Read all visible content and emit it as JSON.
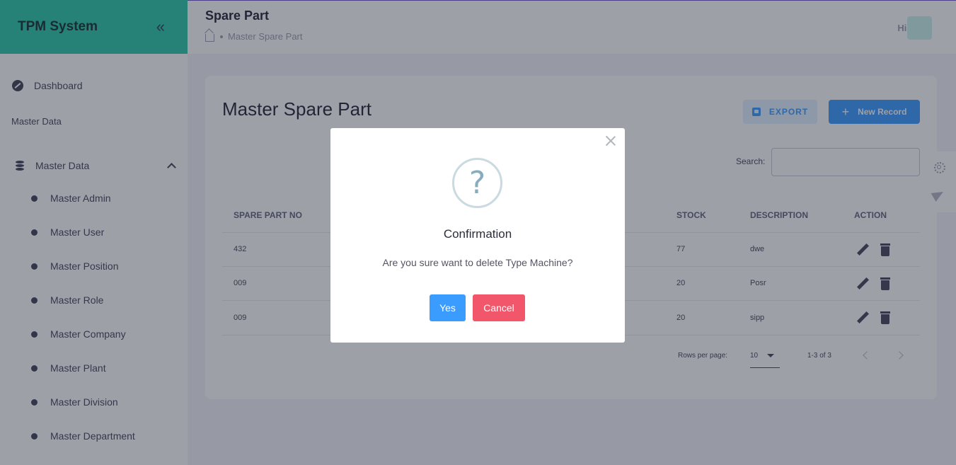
{
  "sidebar": {
    "brand": "TPM System",
    "toggle_glyph": "«",
    "dashboard_label": "Dashboard",
    "section_label": "Master Data",
    "group_label": "Master Data",
    "items": [
      {
        "label": "Master Admin"
      },
      {
        "label": "Master User"
      },
      {
        "label": "Master Position"
      },
      {
        "label": "Master Role"
      },
      {
        "label": "Master Company"
      },
      {
        "label": "Master Plant"
      },
      {
        "label": "Master Division"
      },
      {
        "label": "Master Department"
      }
    ]
  },
  "header": {
    "title": "Spare Part",
    "breadcrumb": "Master Spare Part",
    "greeting": "Hi,"
  },
  "main": {
    "title": "Master Spare Part",
    "export_label": "EXPORT",
    "new_record_label": "New Record",
    "search_label": "Search:",
    "table": {
      "headers": [
        "SPARE PART NO",
        "STOCK",
        "DESCRIPTION",
        "ACTION"
      ],
      "rows": [
        {
          "no": "432",
          "stock": "77",
          "description": "dwe"
        },
        {
          "no": "009",
          "stock": "20",
          "description": "Posr"
        },
        {
          "no": "009",
          "stock": "20",
          "description": "sipp"
        }
      ]
    },
    "pagination": {
      "rows_per_page_label": "Rows per page:",
      "rows_per_page_value": "10",
      "range": "1-3 of 3"
    }
  },
  "modal": {
    "icon_glyph": "?",
    "title": "Confirmation",
    "message": "Are you sure want to delete Type Machine?",
    "yes_label": "Yes",
    "cancel_label": "Cancel"
  },
  "colors": {
    "brand": "#26c6a4",
    "primary": "#3699ff",
    "danger": "#f1566b"
  }
}
